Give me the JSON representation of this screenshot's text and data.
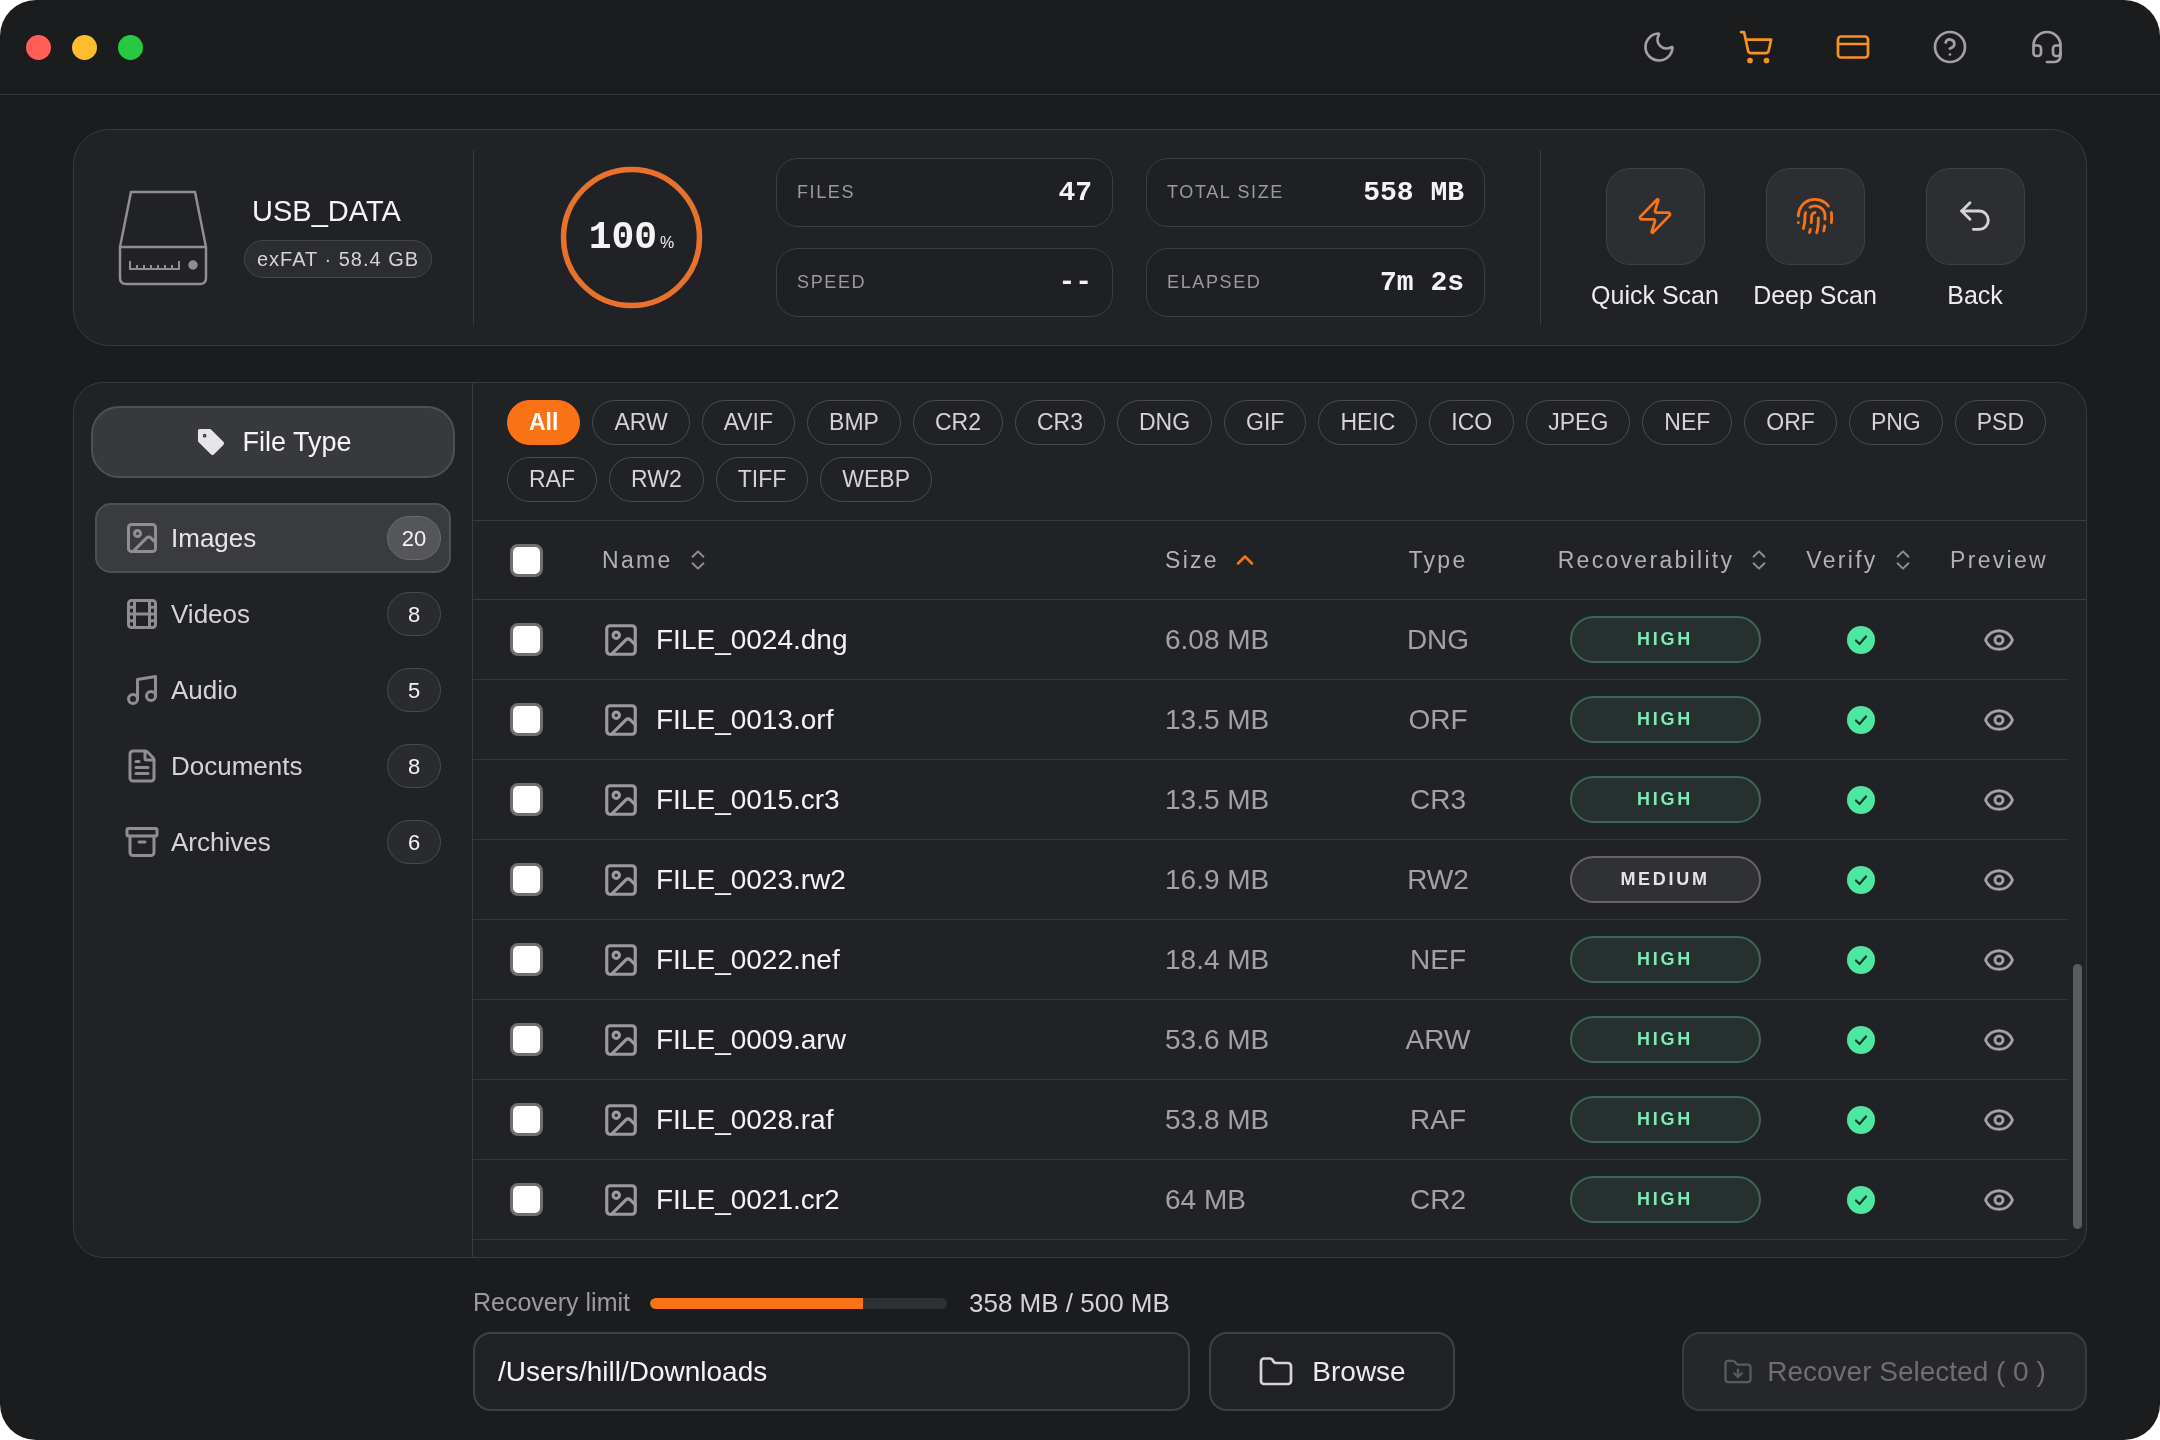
{
  "toolbar": [
    {
      "kind": "theme",
      "highlighted": false
    },
    {
      "kind": "cart",
      "highlighted": true
    },
    {
      "kind": "billing",
      "highlighted": true
    },
    {
      "kind": "help",
      "highlighted": false
    },
    {
      "kind": "support",
      "highlighted": false
    }
  ],
  "drive": {
    "name": "USB_DATA",
    "details": "exFAT · 58.4 GB"
  },
  "progress": {
    "value": "100",
    "unit": "%",
    "level": 1
  },
  "stats": [
    {
      "label": "FILES",
      "value": "47"
    },
    {
      "label": "TOTAL SIZE",
      "value": "558 MB"
    },
    {
      "label": "SPEED",
      "value": "--"
    },
    {
      "label": "ELAPSED",
      "value": "7m 2s"
    }
  ],
  "scan_actions": [
    {
      "kind": "quick",
      "label": "Quick Scan"
    },
    {
      "kind": "deep",
      "label": "Deep Scan"
    },
    {
      "kind": "back",
      "label": "Back"
    }
  ],
  "sidebar": {
    "heading": "File Type",
    "items": [
      {
        "kind": "images",
        "label": "Images",
        "count": "20",
        "selected": true
      },
      {
        "kind": "videos",
        "label": "Videos",
        "count": "8",
        "selected": false
      },
      {
        "kind": "audio",
        "label": "Audio",
        "count": "5",
        "selected": false
      },
      {
        "kind": "documents",
        "label": "Documents",
        "count": "8",
        "selected": false
      },
      {
        "kind": "archives",
        "label": "Archives",
        "count": "6",
        "selected": false
      }
    ]
  },
  "filters": [
    {
      "label": "All",
      "selected": true
    },
    {
      "label": "ARW",
      "selected": false
    },
    {
      "label": "AVIF",
      "selected": false
    },
    {
      "label": "BMP",
      "selected": false
    },
    {
      "label": "CR2",
      "selected": false
    },
    {
      "label": "CR3",
      "selected": false
    },
    {
      "label": "DNG",
      "selected": false
    },
    {
      "label": "GIF",
      "selected": false
    },
    {
      "label": "HEIC",
      "selected": false
    },
    {
      "label": "ICO",
      "selected": false
    },
    {
      "label": "JPEG",
      "selected": false
    },
    {
      "label": "NEF",
      "selected": false
    },
    {
      "label": "ORF",
      "selected": false
    },
    {
      "label": "PNG",
      "selected": false
    },
    {
      "label": "PSD",
      "selected": false
    },
    {
      "label": "RAF",
      "selected": false
    },
    {
      "label": "RW2",
      "selected": false
    },
    {
      "label": "TIFF",
      "selected": false
    },
    {
      "label": "WEBP",
      "selected": false
    }
  ],
  "table": {
    "select_all": {
      "checked": false
    },
    "columns": [
      {
        "label": "Name",
        "sortable": true,
        "sorted": false
      },
      {
        "label": "Size",
        "sortable": true,
        "sorted": true
      },
      {
        "label": "Type",
        "sortable": false,
        "sorted": false
      },
      {
        "label": "Recoverability",
        "sortable": true,
        "sorted": false
      },
      {
        "label": "Verify",
        "sortable": true,
        "sorted": false
      },
      {
        "label": "Preview",
        "sortable": false,
        "sorted": false
      }
    ],
    "rows": [
      {
        "checked": false,
        "name": "FILE_0024.dng",
        "size": "6.08 MB",
        "type": "DNG",
        "recoverability": "HIGH",
        "color": "#7ee8b8",
        "verified": true
      },
      {
        "checked": false,
        "name": "FILE_0013.orf",
        "size": "13.5 MB",
        "type": "ORF",
        "recoverability": "HIGH",
        "color": "#7ee8b8",
        "verified": true
      },
      {
        "checked": false,
        "name": "FILE_0015.cr3",
        "size": "13.5 MB",
        "type": "CR3",
        "recoverability": "HIGH",
        "color": "#7ee8b8",
        "verified": true
      },
      {
        "checked": false,
        "name": "FILE_0023.rw2",
        "size": "16.9 MB",
        "type": "RW2",
        "recoverability": "MEDIUM",
        "color": "#e4e4e7",
        "verified": true
      },
      {
        "checked": false,
        "name": "FILE_0022.nef",
        "size": "18.4 MB",
        "type": "NEF",
        "recoverability": "HIGH",
        "color": "#7ee8b8",
        "verified": true
      },
      {
        "checked": false,
        "name": "FILE_0009.arw",
        "size": "53.6 MB",
        "type": "ARW",
        "recoverability": "HIGH",
        "color": "#7ee8b8",
        "verified": true
      },
      {
        "checked": false,
        "name": "FILE_0028.raf",
        "size": "53.8 MB",
        "type": "RAF",
        "recoverability": "HIGH",
        "color": "#7ee8b8",
        "verified": true
      },
      {
        "checked": false,
        "name": "FILE_0021.cr2",
        "size": "64 MB",
        "type": "CR2",
        "recoverability": "HIGH",
        "color": "#7ee8b8",
        "verified": true
      }
    ]
  },
  "recovery_limit": {
    "label": "Recovery limit",
    "level": 0.716,
    "reading": "358 MB / 500 MB"
  },
  "destination": {
    "value": "/Users/hill/Downloads"
  },
  "browse_button": {
    "label": "Browse"
  },
  "recover_button": {
    "label": "Recover Selected ( 0 )",
    "disabled": true
  }
}
